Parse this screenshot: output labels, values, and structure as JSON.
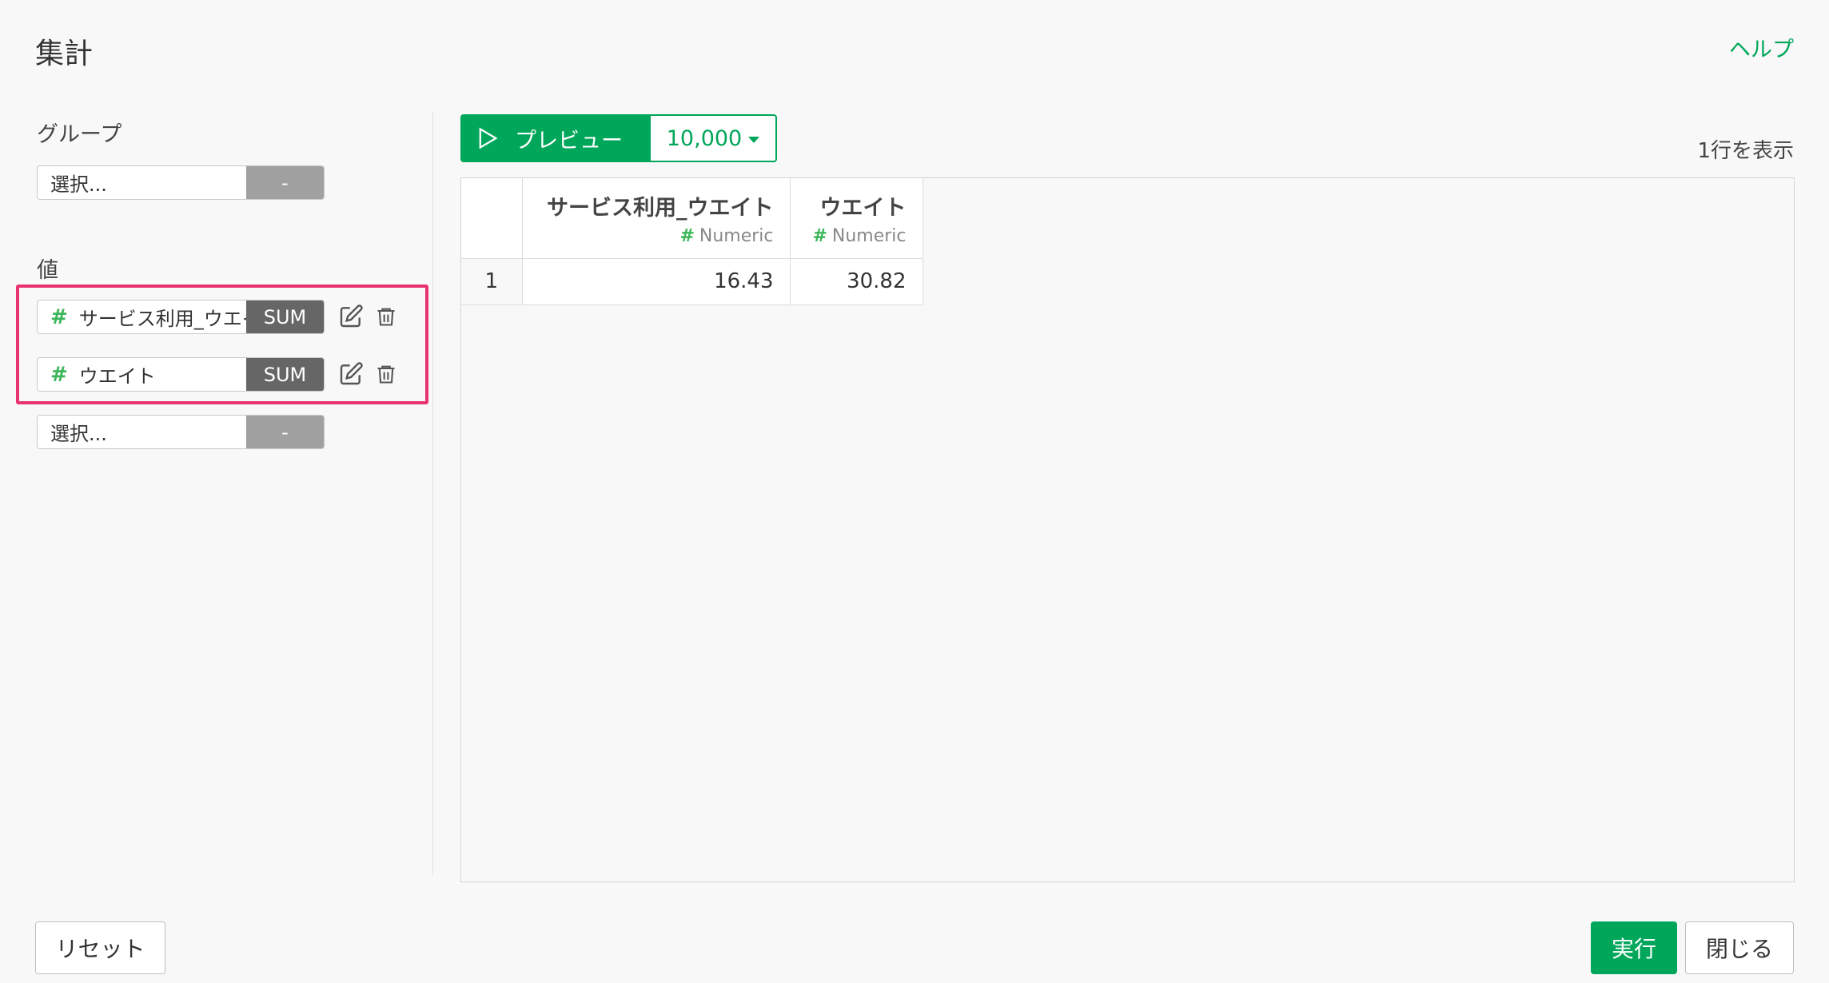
{
  "title": "集計",
  "help_label": "ヘルプ",
  "group": {
    "label": "グループ",
    "selector": {
      "placeholder": "選択...",
      "agg": "-"
    }
  },
  "values": {
    "label": "値",
    "items": [
      {
        "name": "サービス利用_ウエイト",
        "agg": "SUM"
      },
      {
        "name": "ウエイト",
        "agg": "SUM"
      }
    ],
    "empty_selector": {
      "placeholder": "選択...",
      "agg": "-"
    }
  },
  "preview": {
    "button_label": "プレビュー",
    "rows_option": "10,000",
    "row_count_text": "1行を表示"
  },
  "table": {
    "columns": [
      {
        "name": "サービス利用_ウエイト",
        "type": "Numeric"
      },
      {
        "name": "ウエイト",
        "type": "Numeric"
      }
    ],
    "rows": [
      {
        "index": "1",
        "values": [
          "16.43",
          "30.82"
        ]
      }
    ]
  },
  "footer": {
    "reset_label": "リセット",
    "run_label": "実行",
    "close_label": "閉じる"
  },
  "colors": {
    "accent": "#00a65a",
    "highlight": "#e8336e",
    "hash": "#3cb65a"
  }
}
